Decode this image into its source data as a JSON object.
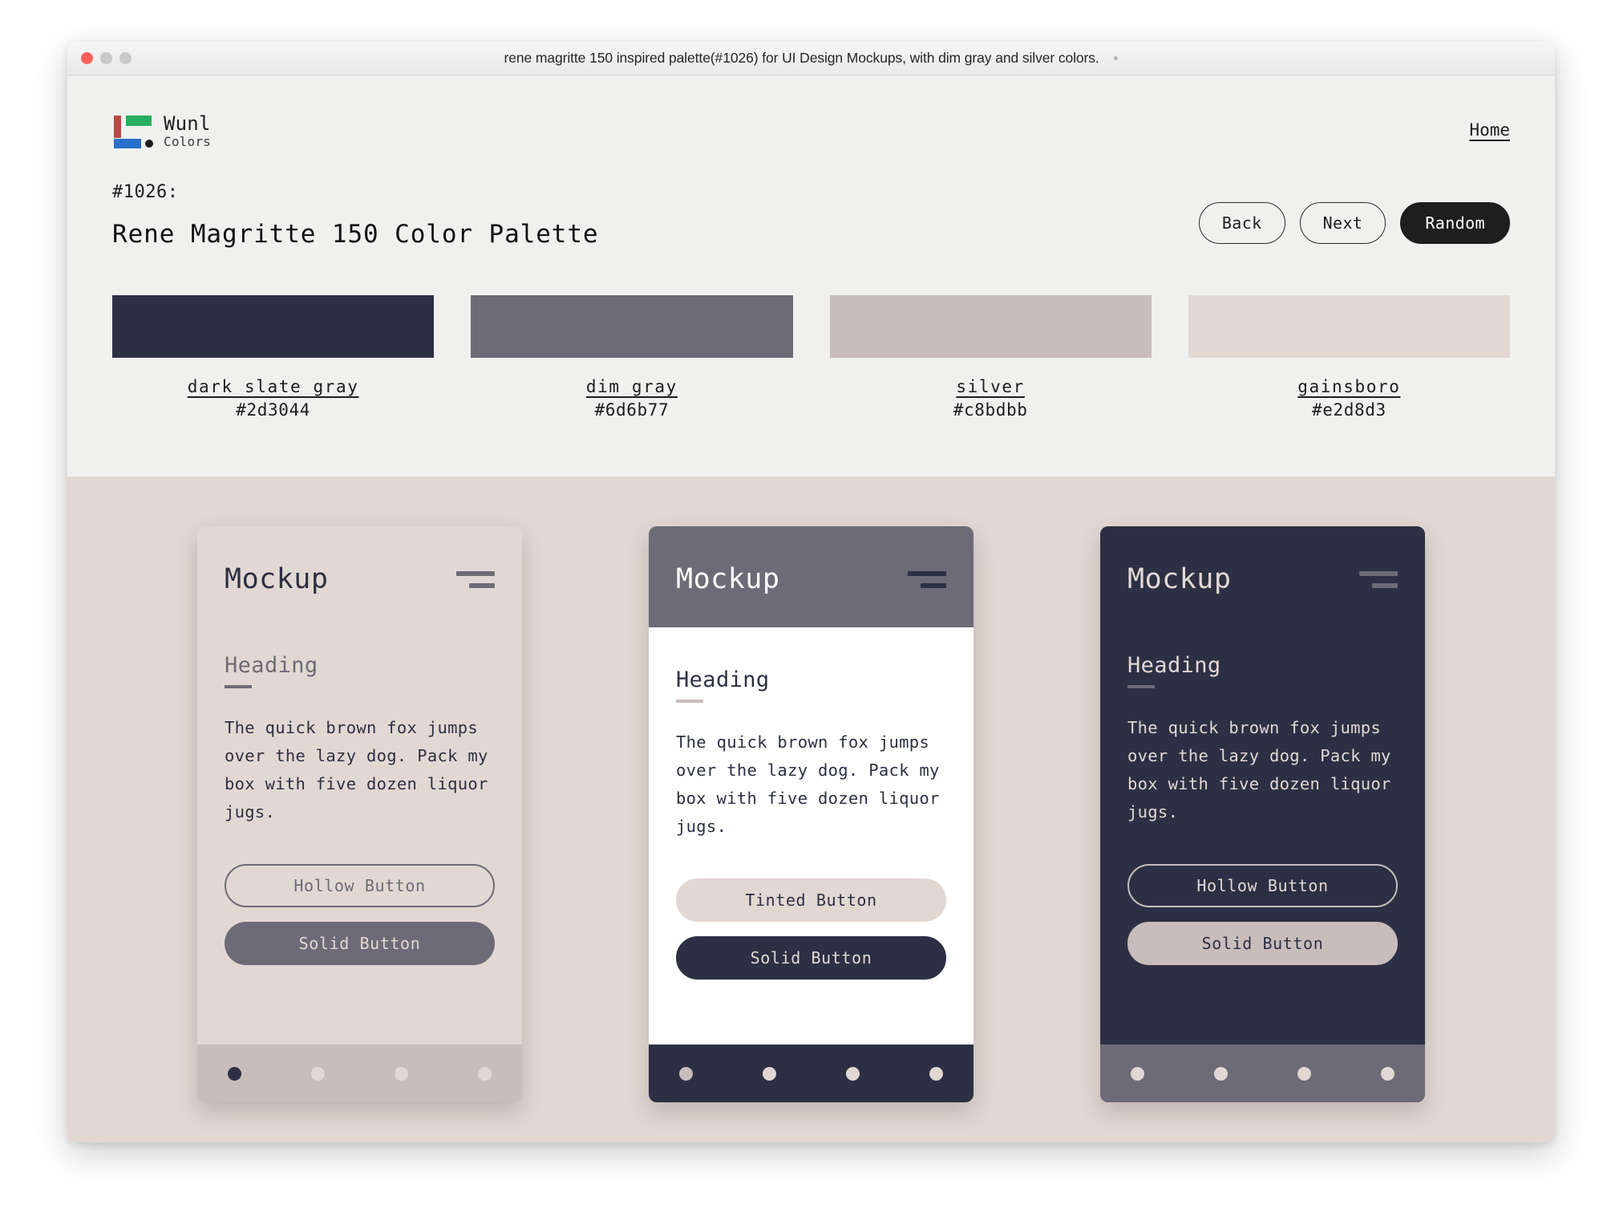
{
  "window": {
    "title": "rene magritte 150 inspired palette(#1026) for UI Design Mockups, with dim gray and silver colors.",
    "traffic_lights": [
      "close-button",
      "minimize-button",
      "zoom-button"
    ]
  },
  "brand": {
    "name": "Wunl",
    "subtitle": "Colors",
    "logo_colors": [
      "#b94a48",
      "#27ae60",
      "#2a6fc9",
      "#1c1c1c"
    ]
  },
  "nav": {
    "home_label": "Home",
    "back_label": "Back",
    "next_label": "Next",
    "random_label": "Random"
  },
  "header": {
    "palette_id": "#1026:",
    "palette_title": "Rene Magritte 150 Color Palette"
  },
  "swatches": [
    {
      "name": "dark slate gray",
      "hex": "#2d3044"
    },
    {
      "name": "dim gray",
      "hex": "#6d6b77"
    },
    {
      "name": "silver",
      "hex": "#c8bdbb"
    },
    {
      "name": "gainsboro",
      "hex": "#e2d8d3"
    }
  ],
  "mockups": [
    {
      "title": "Mockup",
      "heading": "Heading",
      "paragraph": "The quick brown fox jumps over the lazy dog. Pack my box with five dozen liquor jugs.",
      "button_primary": "Hollow Button",
      "button_secondary": "Solid Button"
    },
    {
      "title": "Mockup",
      "heading": "Heading",
      "paragraph": "The quick brown fox jumps over the lazy dog. Pack my box with five dozen liquor jugs.",
      "button_primary": "Tinted Button",
      "button_secondary": "Solid Button"
    },
    {
      "title": "Mockup",
      "heading": "Heading",
      "paragraph": "The quick brown fox jumps over the lazy dog. Pack my box with five dozen liquor jugs.",
      "button_primary": "Hollow Button",
      "button_secondary": "Solid Button"
    }
  ],
  "theme": {
    "dark_slate_gray": "#2d3044",
    "dim_gray": "#6d6b77",
    "silver": "#c8bdbb",
    "gainsboro": "#e2d8d3",
    "white": "#ffffff",
    "panel_bg": "#f0f0ef",
    "accent_dark": "#1e1e1e"
  }
}
